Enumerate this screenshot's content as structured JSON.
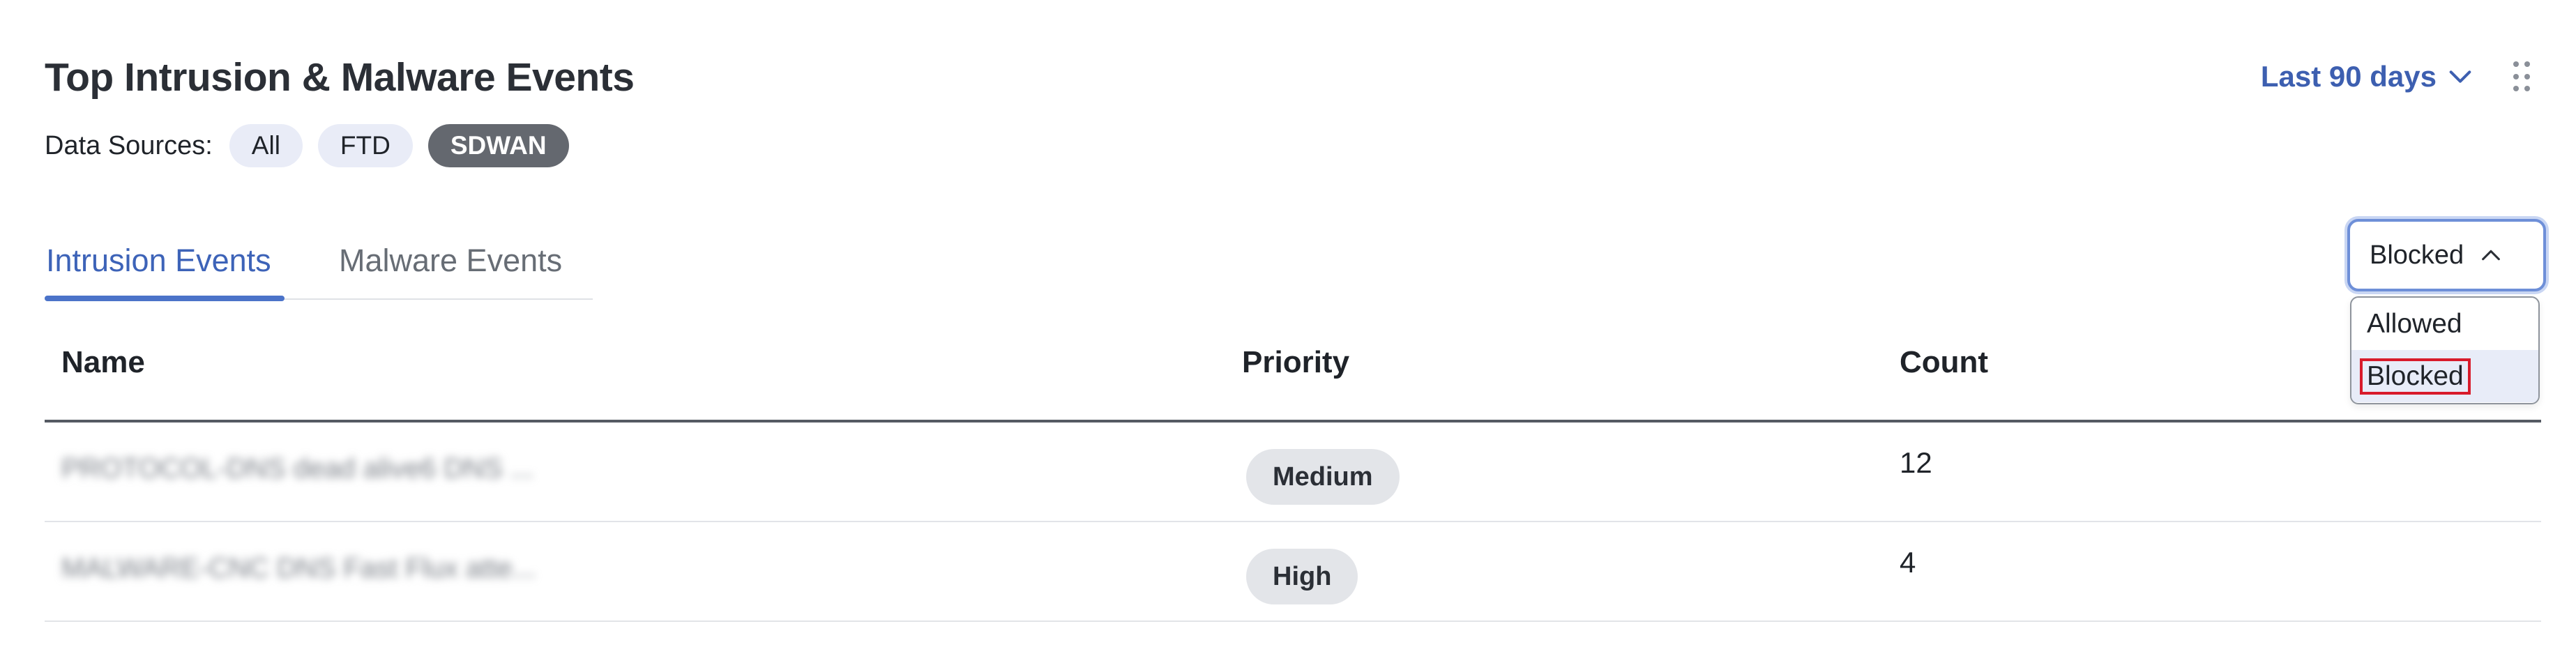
{
  "header": {
    "title": "Top Intrusion & Malware Events",
    "range_label": "Last 90 days"
  },
  "data_sources": {
    "label": "Data Sources:",
    "chips": [
      {
        "label": "All",
        "active": false
      },
      {
        "label": "FTD",
        "active": false
      },
      {
        "label": "SDWAN",
        "active": true
      }
    ]
  },
  "tabs": [
    {
      "label": "Intrusion Events",
      "active": true
    },
    {
      "label": "Malware Events",
      "active": false
    }
  ],
  "filter": {
    "selected": "Blocked",
    "options": [
      "Allowed",
      "Blocked"
    ]
  },
  "table": {
    "columns": [
      "Name",
      "Priority",
      "Count"
    ],
    "rows": [
      {
        "name": "PROTOCOL-DNS dead alive6 DNS ...",
        "priority": "Medium",
        "count": "12"
      },
      {
        "name": "MALWARE-CNC DNS Fast Flux atte...",
        "priority": "High",
        "count": "4"
      }
    ]
  },
  "colors": {
    "accent": "#3d63b8",
    "active_chip": "#64686f",
    "highlight_border": "#d81b2b"
  }
}
